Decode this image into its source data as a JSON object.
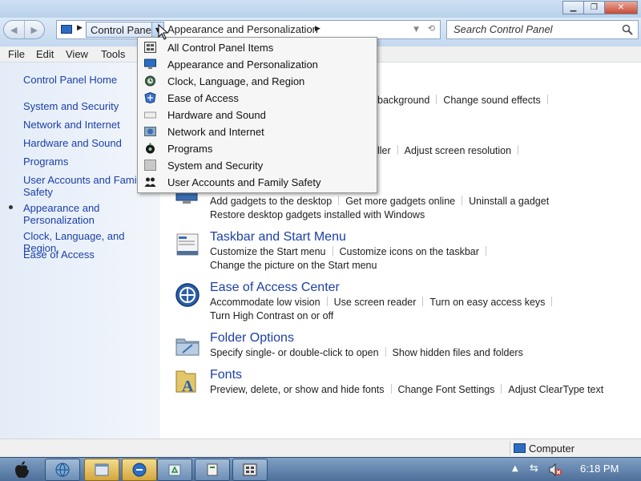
{
  "window": {
    "caption_buttons": [
      "minimize",
      "maximize",
      "close"
    ]
  },
  "navigation": {
    "back_label": "◀",
    "forward_label": "▶",
    "breadcrumb": [
      "Control Panel",
      "Appearance and Personalization"
    ],
    "search_placeholder": "Search Control Panel"
  },
  "menubar": [
    "File",
    "Edit",
    "View",
    "Tools"
  ],
  "leftnav": {
    "home": "Control Panel Home",
    "items": [
      "System and Security",
      "Network and Internet",
      "Hardware and Sound",
      "Programs",
      "User Accounts and Family Safety",
      "Appearance and Personalization",
      "Clock, Language, and Region",
      "Ease of Access"
    ],
    "current": "Appearance and Personalization"
  },
  "dropdown": {
    "items": [
      {
        "label": "All Control Panel Items",
        "icon": "control-panel-icon"
      },
      {
        "label": "Appearance and Personalization",
        "icon": "monitor-icon"
      },
      {
        "label": "Clock, Language, and Region",
        "icon": "clock-icon"
      },
      {
        "label": "Ease of Access",
        "icon": "ease-of-access-icon"
      },
      {
        "label": "Hardware and Sound",
        "icon": "hardware-icon"
      },
      {
        "label": "Network and Internet",
        "icon": "network-icon"
      },
      {
        "label": "Programs",
        "icon": "programs-icon"
      },
      {
        "label": "System and Security",
        "icon": "system-icon"
      },
      {
        "label": "User Accounts and Family Safety",
        "icon": "users-icon"
      }
    ]
  },
  "main": {
    "row_personalization": [
      "background",
      "Change sound effects"
    ],
    "row_display": [
      "ller",
      "Adjust screen resolution"
    ],
    "gadgets": {
      "links_line1": [
        "Add gadgets to the desktop",
        "Get more gadgets online",
        "Uninstall a gadget"
      ],
      "links_line2": [
        "Restore desktop gadgets installed with Windows"
      ]
    },
    "taskbar": {
      "title": "Taskbar and Start Menu",
      "links_line1": [
        "Customize the Start menu",
        "Customize icons on the taskbar"
      ],
      "links_line2": [
        "Change the picture on the Start menu"
      ]
    },
    "ease": {
      "title": "Ease of Access Center",
      "links_line1": [
        "Accommodate low vision",
        "Use screen reader",
        "Turn on easy access keys"
      ],
      "links_line2": [
        "Turn High Contrast on or off"
      ]
    },
    "folder": {
      "title": "Folder Options",
      "links_line1": [
        "Specify single- or double-click to open",
        "Show hidden files and folders"
      ]
    },
    "fonts": {
      "title": "Fonts",
      "links_line1": [
        "Preview, delete, or show and hide fonts",
        "Change Font Settings",
        "Adjust ClearType text"
      ]
    }
  },
  "statusbar": {
    "location": "Computer"
  },
  "taskbar": {
    "clock": "6:18 PM"
  },
  "colors": {
    "link_blue": "#1c3fa8",
    "nav_bg": "#e3ecf8",
    "taskbar_blue": "#5b7ea8"
  }
}
